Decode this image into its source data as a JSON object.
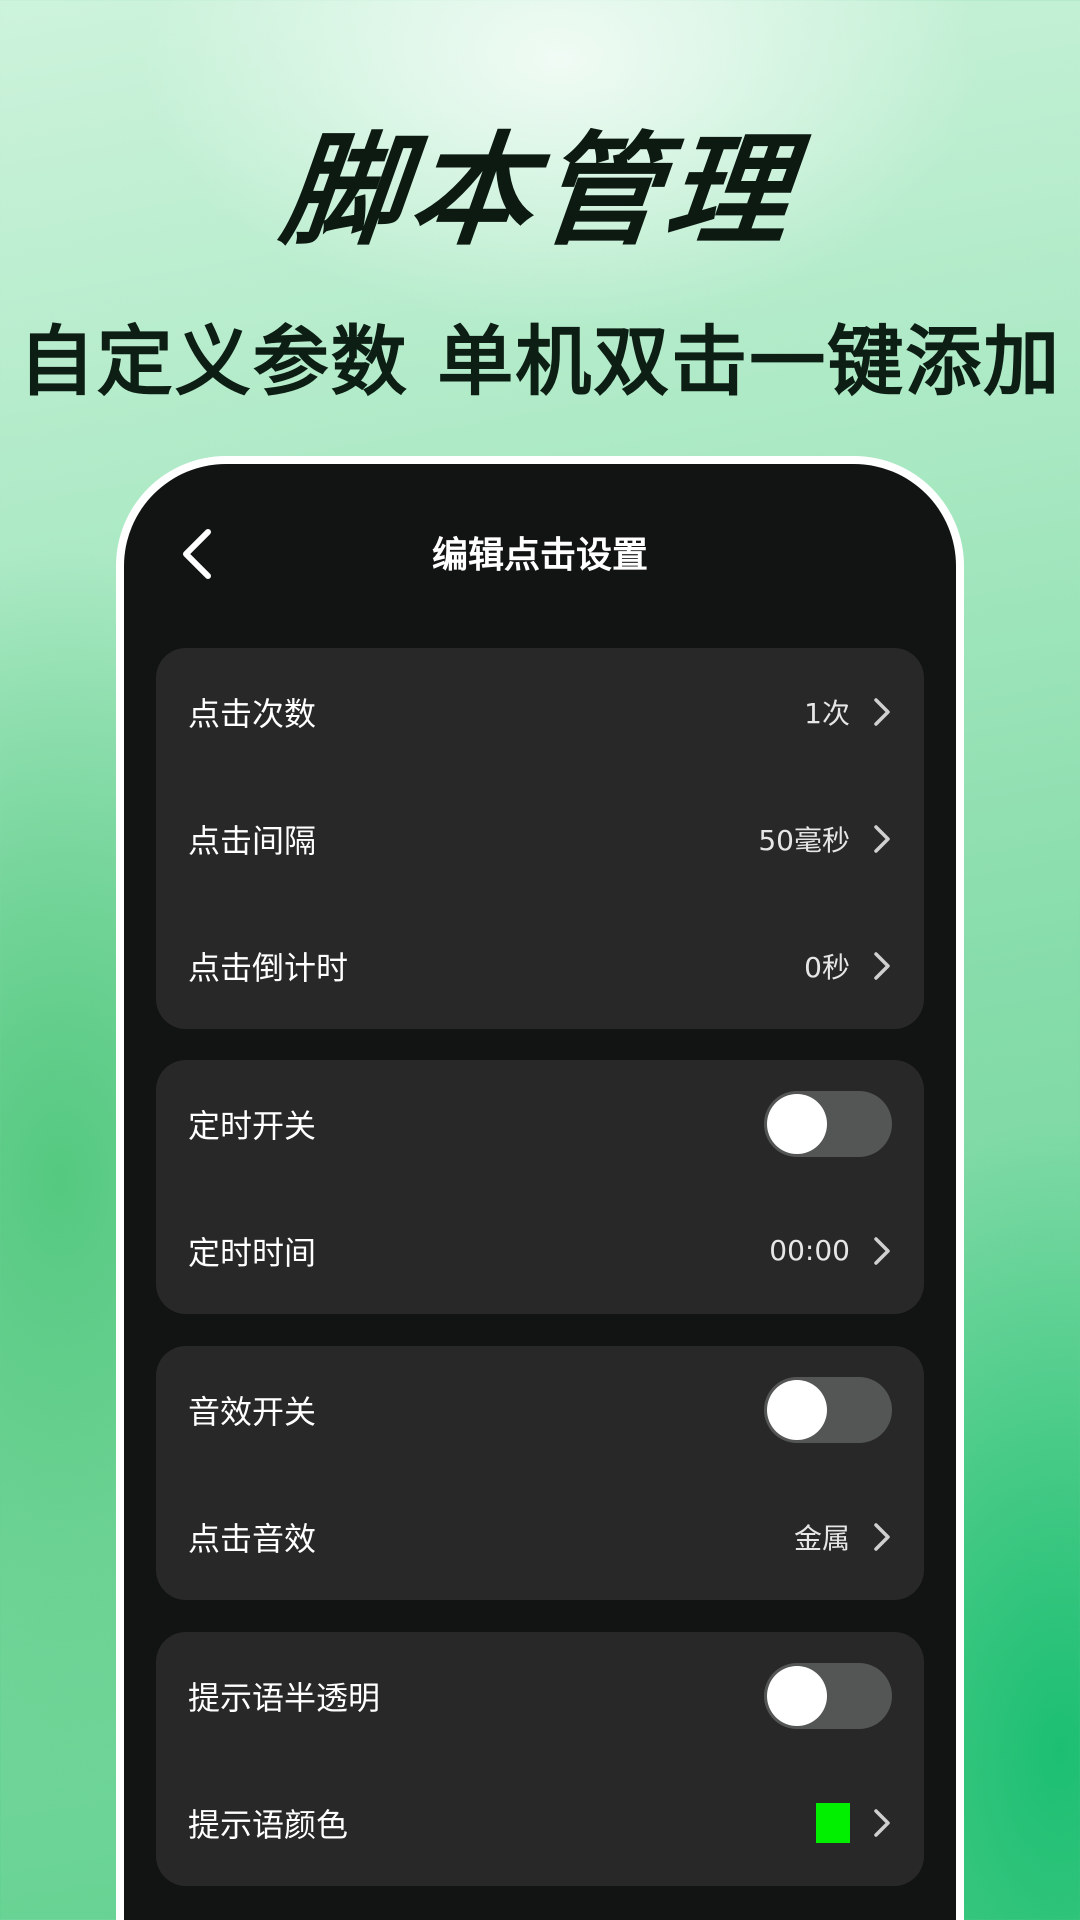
{
  "hero": {
    "title": "脚本管理",
    "subtitle": "自定义参数 单机双击一键添加"
  },
  "nav": {
    "title": "编辑点击设置",
    "back_icon": "chevron-left-icon"
  },
  "cards": [
    {
      "rows": [
        {
          "label": "点击次数",
          "value": "1次",
          "type": "value"
        },
        {
          "label": "点击间隔",
          "value": "50毫秒",
          "type": "value"
        },
        {
          "label": "点击倒计时",
          "value": "0秒",
          "type": "value"
        }
      ]
    },
    {
      "rows": [
        {
          "label": "定时开关",
          "type": "toggle",
          "on": false
        },
        {
          "label": "定时时间",
          "value": "00:00",
          "type": "value"
        }
      ]
    },
    {
      "rows": [
        {
          "label": "音效开关",
          "type": "toggle",
          "on": false
        },
        {
          "label": "点击音效",
          "value": "金属",
          "type": "value"
        }
      ]
    },
    {
      "rows": [
        {
          "label": "提示语半透明",
          "type": "toggle",
          "on": false
        },
        {
          "label": "提示语颜色",
          "type": "color",
          "color": "#00f000"
        }
      ]
    }
  ],
  "colors": {
    "screen_bg": "#121313",
    "card_bg": "#282829",
    "toggle_track_off": "#545555",
    "accent_green": "#00f000"
  }
}
